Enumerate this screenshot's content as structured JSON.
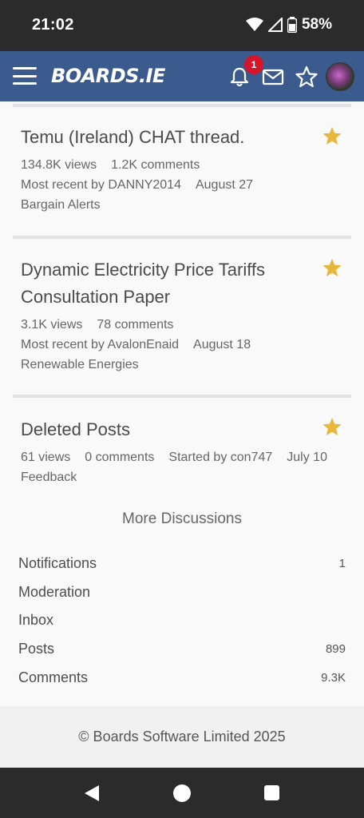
{
  "status_bar": {
    "time": "21:02",
    "battery": "58%"
  },
  "header": {
    "logo": "BOARDS.IE",
    "notification_count": "1"
  },
  "discussions": [
    {
      "title": "Temu (Ireland) CHAT thread.",
      "views": "134.8K views",
      "comments": "1.2K comments",
      "recent": "Most recent by DANNY2014",
      "date": "August 27",
      "category": "Bargain Alerts"
    },
    {
      "title": "Dynamic Electricity Price Tariffs Consultation Paper",
      "views": "3.1K views",
      "comments": "78 comments",
      "recent": "Most recent by AvalonEnaid",
      "date": "August 18",
      "category": "Renewable Energies"
    },
    {
      "title": "Deleted Posts",
      "views": "61 views",
      "comments": "0 comments",
      "started": "Started by con747",
      "date": "July 10",
      "category": "Feedback"
    }
  ],
  "more_discussions": "More Discussions",
  "stats": [
    {
      "label": "Notifications",
      "value": "1"
    },
    {
      "label": "Moderation",
      "value": ""
    },
    {
      "label": "Inbox",
      "value": ""
    },
    {
      "label": "Posts",
      "value": "899"
    },
    {
      "label": "Comments",
      "value": "9.3K"
    }
  ],
  "footer": "© Boards Software Limited 2025",
  "colors": {
    "header_bg": "#3b5b8f",
    "star": "#e8b63a",
    "badge": "#d6152b"
  }
}
